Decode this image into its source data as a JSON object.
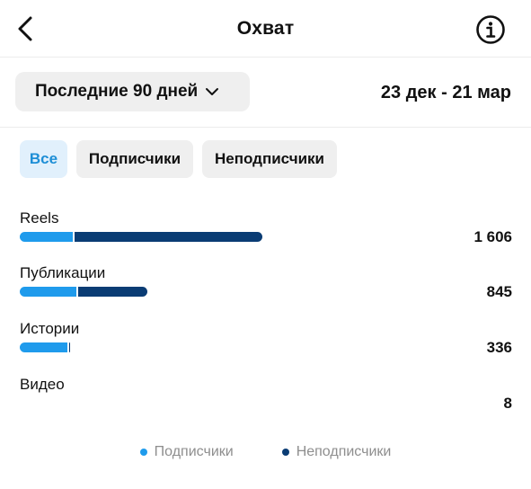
{
  "header": {
    "title": "Охват",
    "back_icon": "chevron-left-icon",
    "info_icon": "info-circle-icon"
  },
  "period": {
    "selected": "Последние 90 дней",
    "date_range": "23 дек - 21 мар"
  },
  "filters": [
    {
      "label": "Все",
      "active": true
    },
    {
      "label": "Подписчики",
      "active": false
    },
    {
      "label": "Неподписчики",
      "active": false
    }
  ],
  "colors": {
    "followers": "#1f9bec",
    "non_followers": "#0a3c74",
    "active_chip_bg": "#e1f0fc",
    "active_chip_text": "#1d8ed6"
  },
  "metrics": [
    {
      "label": "Reels",
      "value": "1 606",
      "total": 1606,
      "followers_share": 0.22
    },
    {
      "label": "Публикации",
      "value": "845",
      "total": 845,
      "followers_share": 0.44
    },
    {
      "label": "Истории",
      "value": "336",
      "total": 336,
      "followers_share": 0.93
    },
    {
      "label": "Видео",
      "value": "8",
      "total": 8,
      "followers_share": 1.0
    }
  ],
  "legend": {
    "followers": "Подписчики",
    "non_followers": "Неподписчики"
  }
}
